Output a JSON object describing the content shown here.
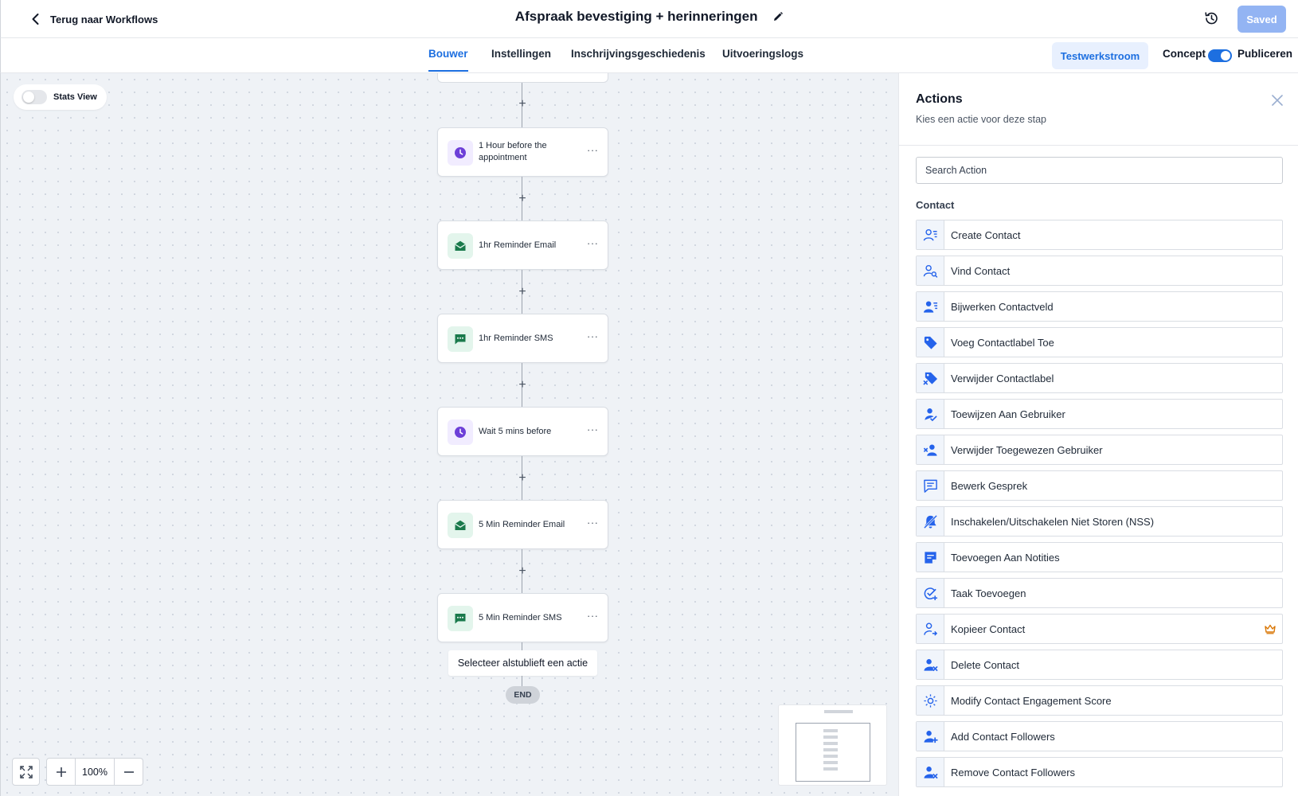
{
  "header": {
    "back_label": "Terug naar Workflows",
    "title": "Afspraak bevestiging + herinneringen",
    "saved_label": "Saved"
  },
  "tabs": [
    {
      "label": "Bouwer",
      "active": true
    },
    {
      "label": "Instellingen",
      "active": false
    },
    {
      "label": "Inschrijvingsgeschiedenis",
      "active": false
    },
    {
      "label": "Uitvoeringslogs",
      "active": false
    }
  ],
  "tabbar_right": {
    "test_label": "Testwerkstroom",
    "concept_label": "Concept",
    "publish_label": "Publiceren",
    "publish_toggle_on": true
  },
  "canvas": {
    "stats_label": "Stats View",
    "stats_on": false,
    "nodes": [
      {
        "label": "1 Hour before the appointment",
        "icon": "clock-icon",
        "kind": "wait"
      },
      {
        "label": "1hr Reminder Email",
        "icon": "email-icon",
        "kind": "email"
      },
      {
        "label": "1hr Reminder SMS",
        "icon": "sms-icon",
        "kind": "sms"
      },
      {
        "label": "Wait 5 mins before",
        "icon": "clock-icon",
        "kind": "wait"
      },
      {
        "label": "5 Min Reminder Email",
        "icon": "email-icon",
        "kind": "email"
      },
      {
        "label": "5 Min Reminder SMS",
        "icon": "sms-icon",
        "kind": "sms"
      }
    ],
    "select_hint": "Selecteer alstublieft een actie",
    "end_label": "END",
    "zoom_value": "100%"
  },
  "panel": {
    "title": "Actions",
    "subtitle": "Kies een actie voor deze stap",
    "search_placeholder": "Search Action",
    "section_label": "Contact",
    "actions": [
      {
        "label": "Create Contact",
        "icon": "person-list-icon"
      },
      {
        "label": "Vind Contact",
        "icon": "person-search-icon"
      },
      {
        "label": "Bijwerken Contactveld",
        "icon": "person-lines-icon"
      },
      {
        "label": "Voeg Contactlabel Toe",
        "icon": "tag-icon"
      },
      {
        "label": "Verwijder Contactlabel",
        "icon": "tag-remove-icon"
      },
      {
        "label": "Toewijzen Aan Gebruiker",
        "icon": "person-assign-icon"
      },
      {
        "label": "Verwijder Toegewezen Gebruiker",
        "icon": "person-unassign-icon"
      },
      {
        "label": "Bewerk Gesprek",
        "icon": "chat-icon"
      },
      {
        "label": "Inschakelen/Uitschakelen Niet Storen (NSS)",
        "icon": "bell-off-icon"
      },
      {
        "label": "Toevoegen Aan Notities",
        "icon": "note-icon"
      },
      {
        "label": "Taak Toevoegen",
        "icon": "task-add-icon"
      },
      {
        "label": "Kopieer Contact",
        "icon": "person-copy-icon",
        "premium": true
      },
      {
        "label": "Delete Contact",
        "icon": "person-delete-icon"
      },
      {
        "label": "Modify Contact Engagement Score",
        "icon": "engagement-icon"
      },
      {
        "label": "Add Contact Followers",
        "icon": "person-add-icon"
      },
      {
        "label": "Remove Contact Followers",
        "icon": "person-remove-icon"
      }
    ]
  },
  "colors": {
    "accent": "#1d6fe0",
    "wait_icon": "#6d3fd8",
    "green_icon": "#1a7a4c",
    "action_icon": "#2563eb",
    "crown": "#d97706"
  }
}
